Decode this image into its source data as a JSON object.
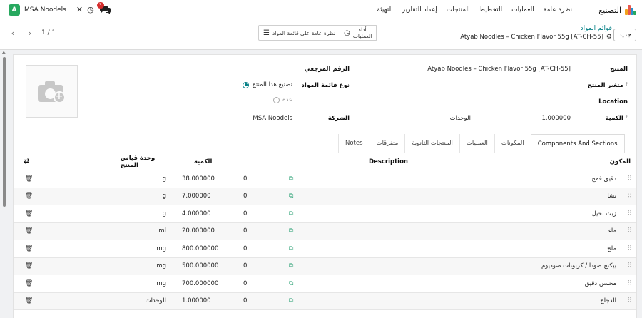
{
  "app": {
    "name": "التصنيع",
    "menus": [
      "نظرة عامة",
      "العمليات",
      "التخطيط",
      "المنتجات",
      "إعداد التقارير",
      "التهيئة"
    ],
    "company_initial": "A",
    "company_name": "MSA Noodels",
    "chat_count": "3",
    "brand_colors": [
      "#f2a31b",
      "#e8584d",
      "#2a8fd0",
      "#27a85f"
    ]
  },
  "control": {
    "new_label": "جديد",
    "breadcrumb_parent": "قوائم المواد",
    "breadcrumb_current": "Atyab Noodles – Chicken Flavor 55g [AT-CH-55]",
    "smart_buttons": {
      "operations_line1": "أداء",
      "operations_line2": "العمليات",
      "overview": "نظرة عامة على قائمة المواد"
    },
    "pager": "1 / 1"
  },
  "form": {
    "product_label": "المنتج",
    "product_value": "Atyab Noodles – Chicken Flavor 55g [AT-CH-55]",
    "variant_label": "متغير المنتج",
    "location_label": "Location",
    "quantity_label": "الكمية",
    "quantity_value": "1.000000",
    "quantity_uom": "الوحدات",
    "reference_label": "الرقم المرجعي",
    "bom_type_label": "نوع قائمة المواد",
    "bom_type_options": [
      "تصنيع هذا المنتج",
      "عدة"
    ],
    "company_label": "الشركة",
    "company_value": "MSA Noodels",
    "tooltip_mark": "?"
  },
  "tabs": [
    "Components And Sections",
    "المكونات",
    "العمليات",
    "المنتجات الثانوية",
    "متفرقات",
    "Notes"
  ],
  "table": {
    "headers": {
      "component": "المكون",
      "description": "Description",
      "quantity": "الكمية",
      "uom": "وحدة قياس المنتج"
    },
    "rows": [
      {
        "component": "دقيق قمح",
        "zero": "0",
        "quantity": "38.000000",
        "uom": "g"
      },
      {
        "component": "نشا",
        "zero": "0",
        "quantity": "7.000000",
        "uom": "g"
      },
      {
        "component": "زيت نخيل",
        "zero": "0",
        "quantity": "4.000000",
        "uom": "g"
      },
      {
        "component": "ماء",
        "zero": "0",
        "quantity": "20.000000",
        "uom": "ml"
      },
      {
        "component": "ملح",
        "zero": "0",
        "quantity": "800.000000",
        "uom": "mg"
      },
      {
        "component": "بيكنج صودا / كربونات صوديوم",
        "zero": "0",
        "quantity": "500.000000",
        "uom": "mg"
      },
      {
        "component": "محسن دقيق",
        "zero": "0",
        "quantity": "700.000000",
        "uom": "mg"
      },
      {
        "component": "الدجاج",
        "zero": "0",
        "quantity": "1.000000",
        "uom": "الوحدات"
      }
    ]
  }
}
